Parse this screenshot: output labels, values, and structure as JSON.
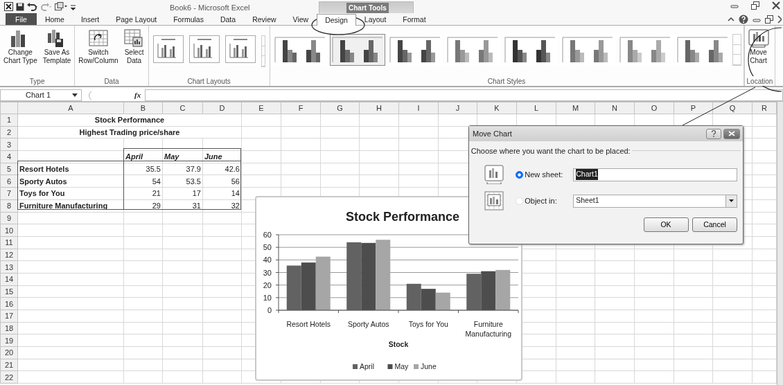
{
  "title_bar": {
    "title": "Book6  -  Microsoft Excel",
    "contextual_label": "Chart Tools"
  },
  "tabs": [
    {
      "label": "File",
      "kind": "file",
      "selected": false
    },
    {
      "label": "Home",
      "kind": "tab",
      "selected": false
    },
    {
      "label": "Insert",
      "kind": "tab",
      "selected": false
    },
    {
      "label": "Page Layout",
      "kind": "tab",
      "selected": false
    },
    {
      "label": "Formulas",
      "kind": "tab",
      "selected": false
    },
    {
      "label": "Data",
      "kind": "tab",
      "selected": false
    },
    {
      "label": "Review",
      "kind": "tab",
      "selected": false
    },
    {
      "label": "View",
      "kind": "tab",
      "selected": false
    },
    {
      "label": "Design",
      "kind": "contextual",
      "selected": true
    },
    {
      "label": "Layout",
      "kind": "contextual",
      "selected": false
    },
    {
      "label": "Format",
      "kind": "contextual",
      "selected": false
    }
  ],
  "ribbon": [
    {
      "label": "Type",
      "kind": "buttons",
      "buttons": [
        "Change\nChart Type",
        "Save As\nTemplate"
      ]
    },
    {
      "label": "Data",
      "kind": "buttons",
      "buttons": [
        "Switch\nRow/Column",
        "Select\nData"
      ]
    },
    {
      "label": "Chart Layouts",
      "kind": "layouts",
      "items": [
        {
          "selected": false
        },
        {
          "selected": false
        },
        {
          "selected": false
        }
      ]
    },
    {
      "label": "Chart Styles",
      "kind": "styles",
      "items": [
        {
          "selected": false
        },
        {
          "selected": true
        },
        {
          "selected": false
        },
        {
          "selected": false
        },
        {
          "selected": false
        },
        {
          "selected": false
        },
        {
          "selected": false
        },
        {
          "selected": false
        }
      ]
    },
    {
      "label": "Location",
      "kind": "buttons",
      "buttons": [
        "Move\nChart"
      ]
    }
  ],
  "formula_bar": {
    "name_box": "Chart 1",
    "function_label": "fx"
  },
  "sheet": {
    "columns": [
      "A",
      "B",
      "C",
      "D",
      "E",
      "F",
      "G",
      "H",
      "I",
      "J",
      "K",
      "L",
      "M",
      "N",
      "O",
      "P",
      "Q",
      "R"
    ],
    "row_numbers": [
      "1",
      "2",
      "3",
      "4",
      "5",
      "6",
      "7",
      "8",
      "9",
      "10",
      "11",
      "12",
      "13",
      "14",
      "15",
      "16",
      "17",
      "18",
      "19",
      "20",
      "21",
      "22"
    ],
    "title": "Stock Performance",
    "subtitle": "Highest Trading price/share",
    "table": {
      "columns": [
        "April",
        "May",
        "June"
      ],
      "rows": [
        {
          "label": "Resort Hotels",
          "values": [
            "35.5",
            "37.9",
            "42.6"
          ]
        },
        {
          "label": "Sporty Autos",
          "values": [
            "54",
            "53.5",
            "56"
          ]
        },
        {
          "label": "Toys for You",
          "values": [
            "21",
            "17",
            "14"
          ]
        },
        {
          "label": "Furniture Manufacturing",
          "values": [
            "29",
            "31",
            "32"
          ]
        }
      ]
    }
  },
  "chart": {
    "chart_data": {
      "type": "bar",
      "title": "Stock Performance",
      "xlabel": "Stock",
      "categories": [
        "Resort Hotels",
        "Sporty Autos",
        "Toys for You",
        "Furniture\nManufacturing"
      ],
      "series": [
        {
          "name": "April",
          "color": "#626262",
          "values": [
            35.5,
            54,
            21,
            29
          ]
        },
        {
          "name": "May",
          "color": "#4d4d4d",
          "values": [
            37.9,
            53.5,
            17,
            31
          ]
        },
        {
          "name": "June",
          "color": "#a6a6a6",
          "values": [
            42.6,
            56,
            14,
            32
          ]
        }
      ],
      "ylim": [
        0,
        60
      ],
      "yticks": [
        0,
        10,
        20,
        30,
        40,
        50,
        60
      ],
      "grid": true,
      "legend": "bottom"
    }
  },
  "dialog": {
    "title": "Move Chart",
    "prompt": "Choose where you want the chart to be placed:",
    "options": [
      {
        "label": "New sheet:",
        "kind": "text",
        "selected": true,
        "value": "Chart1",
        "highlighted": true
      },
      {
        "label": "Object in:",
        "kind": "dropdown",
        "selected": false,
        "value": "Sheet1",
        "highlighted": false
      }
    ],
    "buttons": [
      "OK",
      "Cancel"
    ]
  }
}
